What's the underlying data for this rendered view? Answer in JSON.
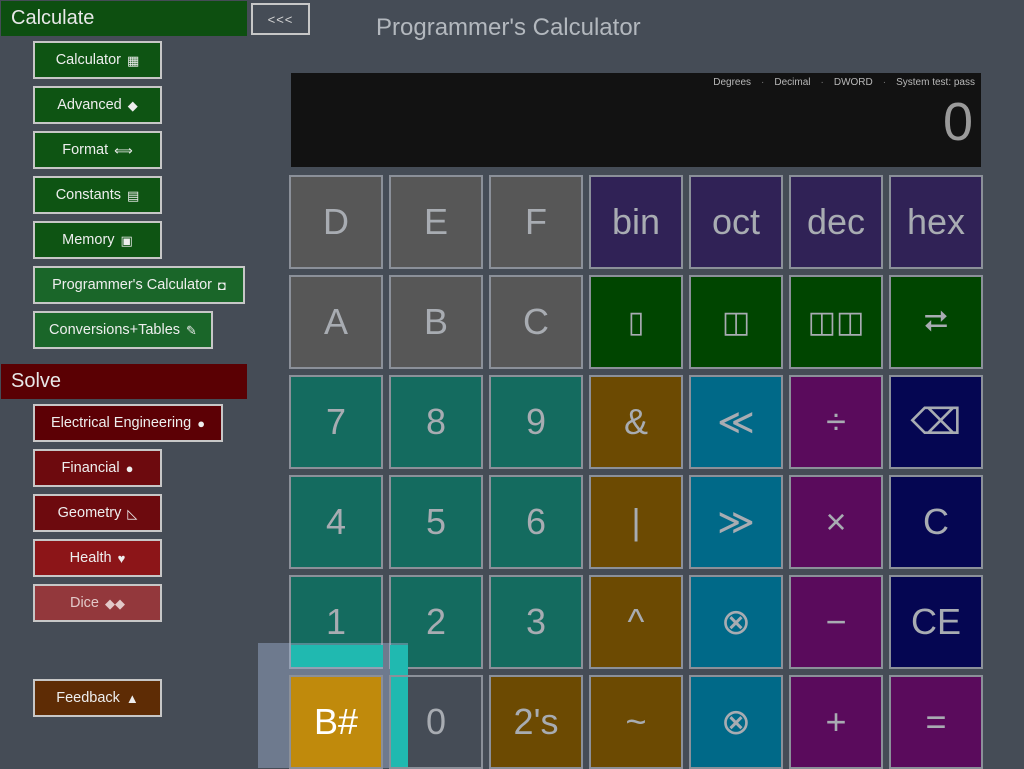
{
  "sidebar": {
    "calculate_header": "Calculate",
    "solve_header": "Solve",
    "calculate_items": [
      {
        "label": "Calculator",
        "icon": "calculator-icon"
      },
      {
        "label": "Advanced",
        "icon": "graduation-cap-icon"
      },
      {
        "label": "Format",
        "icon": "left-right-arrow-icon"
      },
      {
        "label": "Constants",
        "icon": "table-icon"
      },
      {
        "label": "Memory",
        "icon": "memory-card-icon"
      },
      {
        "label": "Programmer's Calculator",
        "icon": "chip-icon"
      },
      {
        "label": "Conversions+Tables",
        "icon": "pencil-icon"
      }
    ],
    "solve_items": [
      {
        "label": "Electrical Engineering",
        "icon": "lightbulb-icon"
      },
      {
        "label": "Financial",
        "icon": "money-bag-icon"
      },
      {
        "label": "Geometry",
        "icon": "set-square-icon"
      },
      {
        "label": "Health",
        "icon": "heart-icon"
      },
      {
        "label": "Dice",
        "icon": "dice-icon"
      }
    ],
    "feedback_label": "Feedback"
  },
  "header": {
    "back_label": "<<<",
    "title": "Programmer's Calculator"
  },
  "display": {
    "status": [
      "Degrees",
      "Decimal",
      "DWORD",
      "System test: pass"
    ],
    "separator": "·",
    "value": "0"
  },
  "keypad": {
    "row1": [
      "D",
      "E",
      "F",
      "bin",
      "oct",
      "dec",
      "hex"
    ],
    "row2": [
      "A",
      "B",
      "C",
      "▯",
      "◫",
      "◫◫",
      "⮂"
    ],
    "row3": [
      "7",
      "8",
      "9",
      "&",
      "≪",
      "÷",
      "⌫"
    ],
    "row4": [
      "4",
      "5",
      "6",
      "|",
      "≫",
      "×",
      "C"
    ],
    "row5": [
      "1",
      "2",
      "3",
      "^",
      "⊗",
      "−",
      "CE"
    ],
    "row6": [
      "B#",
      "0",
      "2's",
      "~",
      "⊗",
      "+",
      "="
    ]
  },
  "colors": {
    "calculate_green": "#0d4f10",
    "solve_red": "#5a0003",
    "key_gray": "#575757",
    "key_indigo": "#302256",
    "key_green": "#004500",
    "key_teal": "#146b5f",
    "key_amber": "#6c4a02",
    "key_blue": "#006988",
    "key_purple": "#5a0b5c",
    "key_navy": "#050652",
    "key_gold": "#c08a0c"
  }
}
